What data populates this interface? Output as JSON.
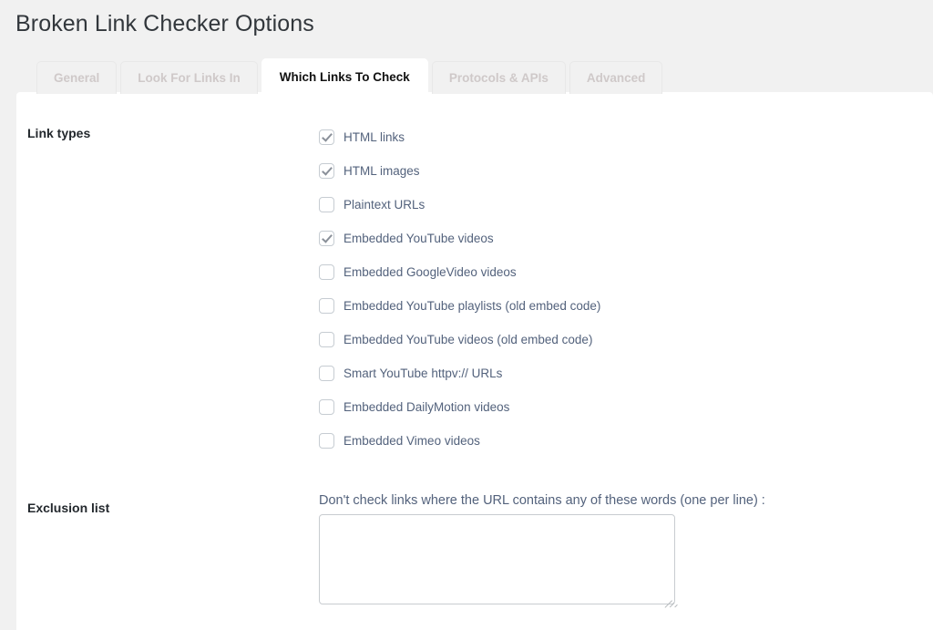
{
  "page": {
    "title": "Broken Link Checker Options"
  },
  "tabs": [
    {
      "label": "General",
      "active": false
    },
    {
      "label": "Look For Links In",
      "active": false
    },
    {
      "label": "Which Links To Check",
      "active": true
    },
    {
      "label": "Protocols & APIs",
      "active": false
    },
    {
      "label": "Advanced",
      "active": false
    }
  ],
  "link_types": {
    "label": "Link types",
    "items": [
      {
        "label": "HTML links",
        "checked": true
      },
      {
        "label": "HTML images",
        "checked": true
      },
      {
        "label": "Plaintext URLs",
        "checked": false
      },
      {
        "label": "Embedded YouTube videos",
        "checked": true
      },
      {
        "label": "Embedded GoogleVideo videos",
        "checked": false
      },
      {
        "label": "Embedded YouTube playlists (old embed code)",
        "checked": false
      },
      {
        "label": "Embedded YouTube videos (old embed code)",
        "checked": false
      },
      {
        "label": "Smart YouTube httpv:// URLs",
        "checked": false
      },
      {
        "label": "Embedded DailyMotion videos",
        "checked": false
      },
      {
        "label": "Embedded Vimeo videos",
        "checked": false
      }
    ]
  },
  "exclusion_list": {
    "label": "Exclusion list",
    "heading": "Don't check links where the URL contains any of these words (one per line) :",
    "textarea_value": "",
    "textarea_placeholder": ""
  },
  "colors": {
    "page_background": "#f1f1f1",
    "panel_background": "#ffffff",
    "title_text": "#32373c",
    "label_text": "#23282d",
    "option_text": "#53627c",
    "tab_inactive_text": "#cfc9c9",
    "tab_active_text": "#111111",
    "checkbox_border": "#c6ccd2",
    "checkmark": "#8a9099",
    "input_border": "#c8ccd0"
  }
}
